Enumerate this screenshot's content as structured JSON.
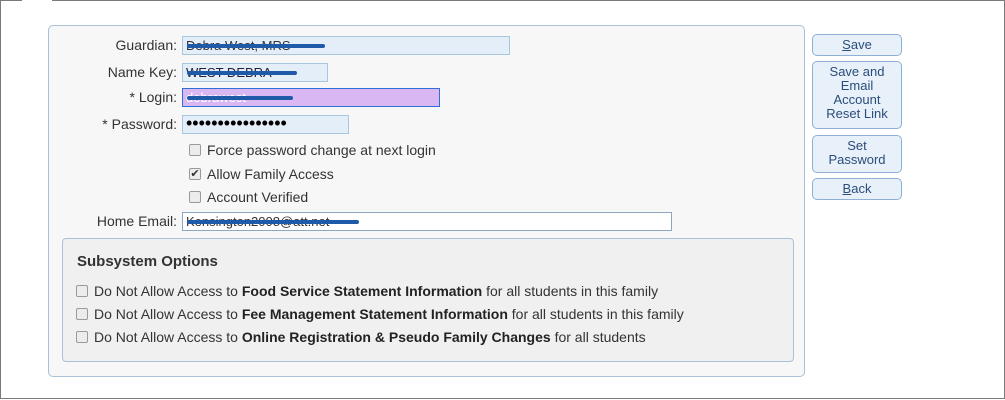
{
  "form": {
    "guardian_label": "Guardian:",
    "guardian_value": "Debra West, MRS",
    "namekey_label": "Name Key:",
    "namekey_value": "WEST DEBRA",
    "login_label": "* Login:",
    "login_value": "debrawest",
    "password_label": "* Password:",
    "password_value": "••••••••••••••••",
    "force_pw_label": "Force password change at next login",
    "force_pw_checked": false,
    "allow_family_label": "Allow Family Access",
    "allow_family_checked": true,
    "account_verified_label": "Account Verified",
    "account_verified_checked": false,
    "email_label": "Home Email:",
    "email_value": "Kensington2008@att.net"
  },
  "subsystem": {
    "title": "Subsystem Options",
    "options": [
      {
        "prefix": "Do Not Allow Access to ",
        "bold": "Food Service Statement Information",
        "suffix": " for all students in this family",
        "checked": false
      },
      {
        "prefix": "Do Not Allow Access to ",
        "bold": "Fee Management Statement Information",
        "suffix": " for all students in this family",
        "checked": false
      },
      {
        "prefix": "Do Not Allow Access to ",
        "bold": "Online Registration & Pseudo Family Changes",
        "suffix": " for all students",
        "checked": false
      }
    ]
  },
  "buttons": {
    "save_key": "S",
    "save_rest": "ave",
    "save_email": "Save and Email Account Reset Link",
    "set_password": "Set Password",
    "back_key": "B",
    "back_rest": "ack"
  },
  "colors": {
    "accent_border": "#a9c0d8",
    "login_bg": "#d9b7f3",
    "redaction": "#1f5aa8"
  },
  "icons": {
    "checkmark": "check-icon"
  }
}
